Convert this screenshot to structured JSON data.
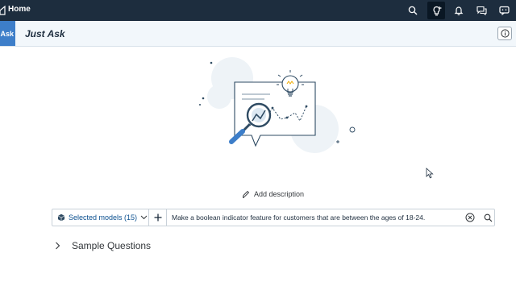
{
  "shell": {
    "home_label": "Home",
    "icons": [
      "search-icon",
      "bulb-icon",
      "bell-icon",
      "feedback-icon",
      "chat-icon"
    ]
  },
  "subheader": {
    "badge": "Ask",
    "title": "Just Ask",
    "info_icon": "info-icon"
  },
  "main": {
    "add_description": "Add description",
    "models_label": "Selected models (15)",
    "query_value": "Make a boolean indicator feature for customers that are between the ages of 18-24.",
    "sample_questions": "Sample Questions"
  },
  "colors": {
    "shell_bg": "#1d2d3e",
    "accent": "#3d7ec9",
    "subheader_bg": "#f2f7fb"
  }
}
